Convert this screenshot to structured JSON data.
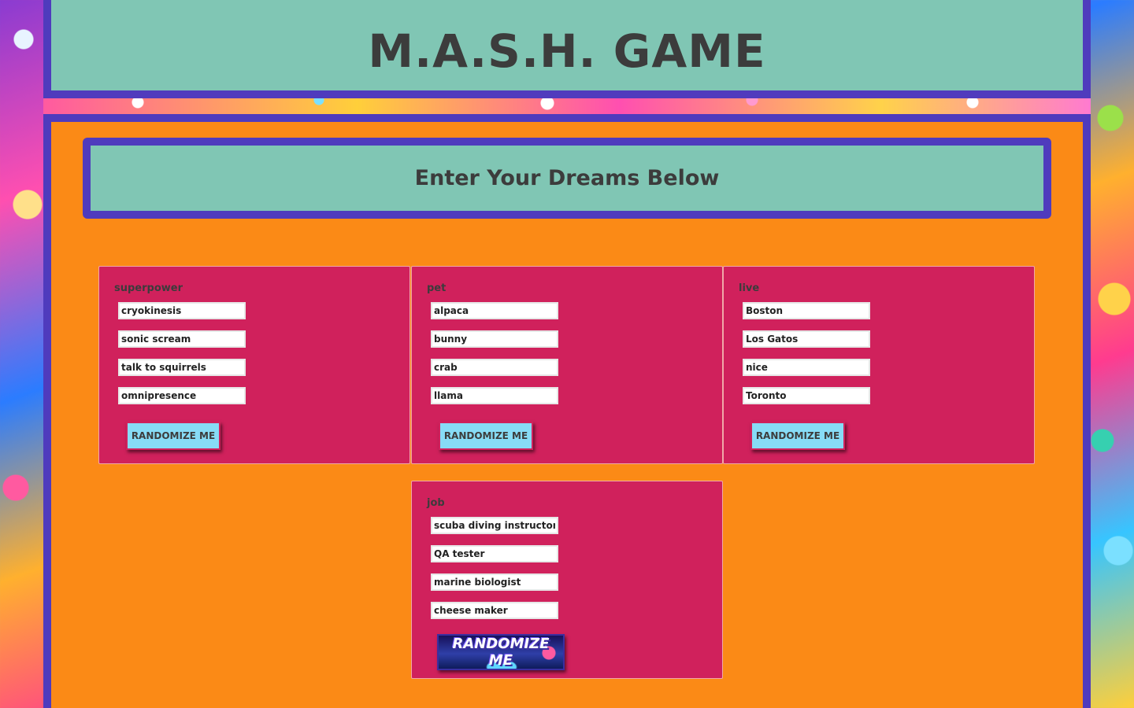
{
  "header": {
    "title": "M.A.S.H. GAME"
  },
  "main": {
    "dreams_title": "Enter Your Dreams Below",
    "categories": [
      {
        "label": "superpower",
        "values": [
          "cryokinesis",
          "sonic scream",
          "talk to squirrels",
          "omnipresence"
        ],
        "button_label": "RANDOMIZE ME"
      },
      {
        "label": "pet",
        "values": [
          "alpaca",
          "bunny",
          "crab",
          "llama"
        ],
        "button_label": "RANDOMIZE ME"
      },
      {
        "label": "live",
        "values": [
          "Boston",
          "Los Gatos",
          "nice",
          "Toronto"
        ],
        "button_label": "RANDOMIZE ME"
      },
      {
        "label": "job",
        "values": [
          "scuba diving instructor",
          "QA tester",
          "marine biologist",
          "cheese maker"
        ],
        "button_label": "RANDOMIZE ME"
      }
    ]
  },
  "colors": {
    "header_bg": "#80c6b4",
    "border": "#4f3bbd",
    "main_bg": "#fb8a16",
    "card_bg": "#d0215c",
    "button_bg": "#87dcf6"
  }
}
